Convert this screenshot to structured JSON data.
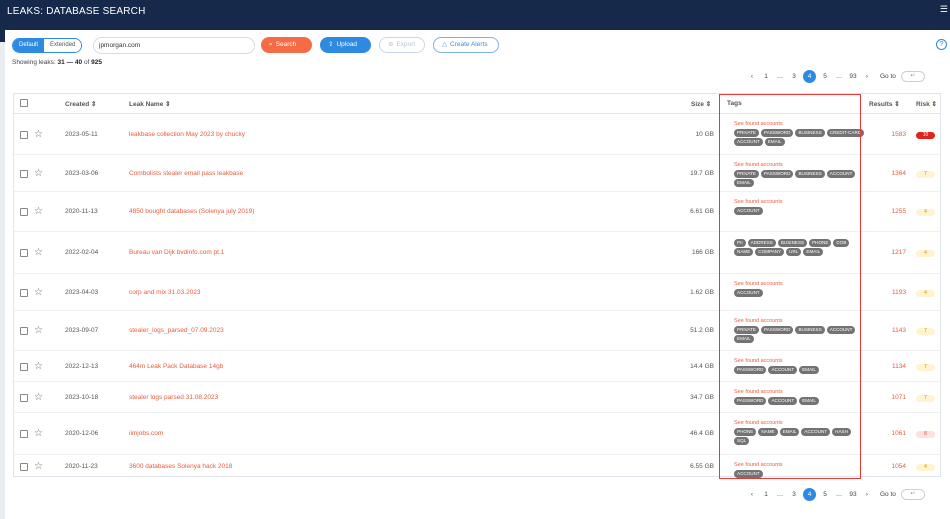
{
  "app": {
    "title": "LEAKS: DATABASE SEARCH"
  },
  "toolbar": {
    "mode_default": "Default",
    "mode_extended": "Extended",
    "search_value": "jpmorgan.com",
    "search_label": "Search",
    "upload_label": "Upload",
    "export_label": "Export",
    "alerts_label": "Create Alerts",
    "help": "?"
  },
  "summary": {
    "prefix": "Showing leaks:",
    "range": "31 — 40",
    "of": "of",
    "total": "925"
  },
  "pagination": {
    "prev": "‹",
    "pages_before": [
      "1",
      "…",
      "3"
    ],
    "current": "4",
    "pages_after": [
      "5",
      "…",
      "93"
    ],
    "next": "›",
    "goto_label": "Go to",
    "goto_placeholder": "↵"
  },
  "columns": {
    "created": "Created ⇕",
    "leak_name": "Leak Name ⇕",
    "size": "Size ⇕",
    "tags": "Tags",
    "results": "Results ⇕",
    "risk": "Risk ⇕"
  },
  "see_found_label": "See found accounts",
  "rows": [
    {
      "created": "2023-05-11",
      "name": "leakbase collection May 2023 by chucky",
      "size": "10 GB",
      "results": "1583",
      "risk": "10",
      "risk_level": "high",
      "see": true,
      "tags": [
        "PRIVATE",
        "PASSWORD",
        "BUSINESS",
        "CREDIT-CARD",
        "ACCOUNT",
        "EMAIL"
      ]
    },
    {
      "created": "2023-03-06",
      "name": "Combolists stealer email pass leakbase",
      "size": "19.7 GB",
      "results": "1364",
      "risk": "7",
      "risk_level": "yellow",
      "see": true,
      "tags": [
        "PRIVATE",
        "PASSWORD",
        "BUSINESS",
        "ACCOUNT",
        "EMAIL"
      ]
    },
    {
      "created": "2020-11-13",
      "name": "4850 bought databases (Solenya july 2019)",
      "size": "6.61 GB",
      "results": "1255",
      "risk": "4",
      "risk_level": "yellow",
      "see": true,
      "tags": [
        "ACCOUNT"
      ]
    },
    {
      "created": "2022-02-04",
      "name": "Bureau van Dijk bvdinfo.com pt.1",
      "size": "166 GB",
      "results": "1217",
      "risk": "4",
      "risk_level": "yellow",
      "see": false,
      "tags": [
        "PII",
        "ADDRESS",
        "BUSINESS",
        "PHONE",
        "DOB",
        "NAME",
        "COMPANY",
        "URL",
        "EMAIL"
      ]
    },
    {
      "created": "2023-04-03",
      "name": "corp and mix 31.03.2023",
      "size": "1.62 GB",
      "results": "1193",
      "risk": "4",
      "risk_level": "yellow",
      "see": true,
      "tags": [
        "ACCOUNT"
      ]
    },
    {
      "created": "2023-09-07",
      "name": "stealer_logs_parsed_07.09.2023",
      "size": "51.2 GB",
      "results": "1143",
      "risk": "7",
      "risk_level": "yellow",
      "see": true,
      "tags": [
        "PRIVATE",
        "PASSWORD",
        "BUSINESS",
        "ACCOUNT",
        "EMAIL"
      ]
    },
    {
      "created": "2022-12-13",
      "name": "464m Leak Pack Database 14gb",
      "size": "14.4 GB",
      "results": "1134",
      "risk": "7",
      "risk_level": "yellow",
      "see": true,
      "tags": [
        "PASSWORD",
        "ACCOUNT",
        "EMAIL"
      ]
    },
    {
      "created": "2023-10-18",
      "name": "stealer logs parsed 31.08.2023",
      "size": "34.7 GB",
      "results": "1071",
      "risk": "7",
      "risk_level": "yellow",
      "see": true,
      "tags": [
        "PASSWORD",
        "ACCOUNT",
        "EMAIL"
      ]
    },
    {
      "created": "2020-12-06",
      "name": "iimjobs.com",
      "size": "46.4 GB",
      "results": "1061",
      "risk": "8",
      "risk_level": "pink",
      "see": true,
      "tags": [
        "PHONE",
        "NAME",
        "EMAIL",
        "ACCOUNT",
        "HASH",
        "SQL"
      ]
    },
    {
      "created": "2020-11-23",
      "name": "3600 databases Solenya hack 2018",
      "size": "6.55 GB",
      "results": "1054",
      "risk": "4",
      "risk_level": "yellow",
      "see": true,
      "tags": [
        "ACCOUNT"
      ]
    }
  ],
  "colors": {
    "header": "#16294a",
    "accent": "#2d8ae0",
    "search": "#f46b45",
    "link": "#e85d3d",
    "highlight": "#e53935"
  }
}
